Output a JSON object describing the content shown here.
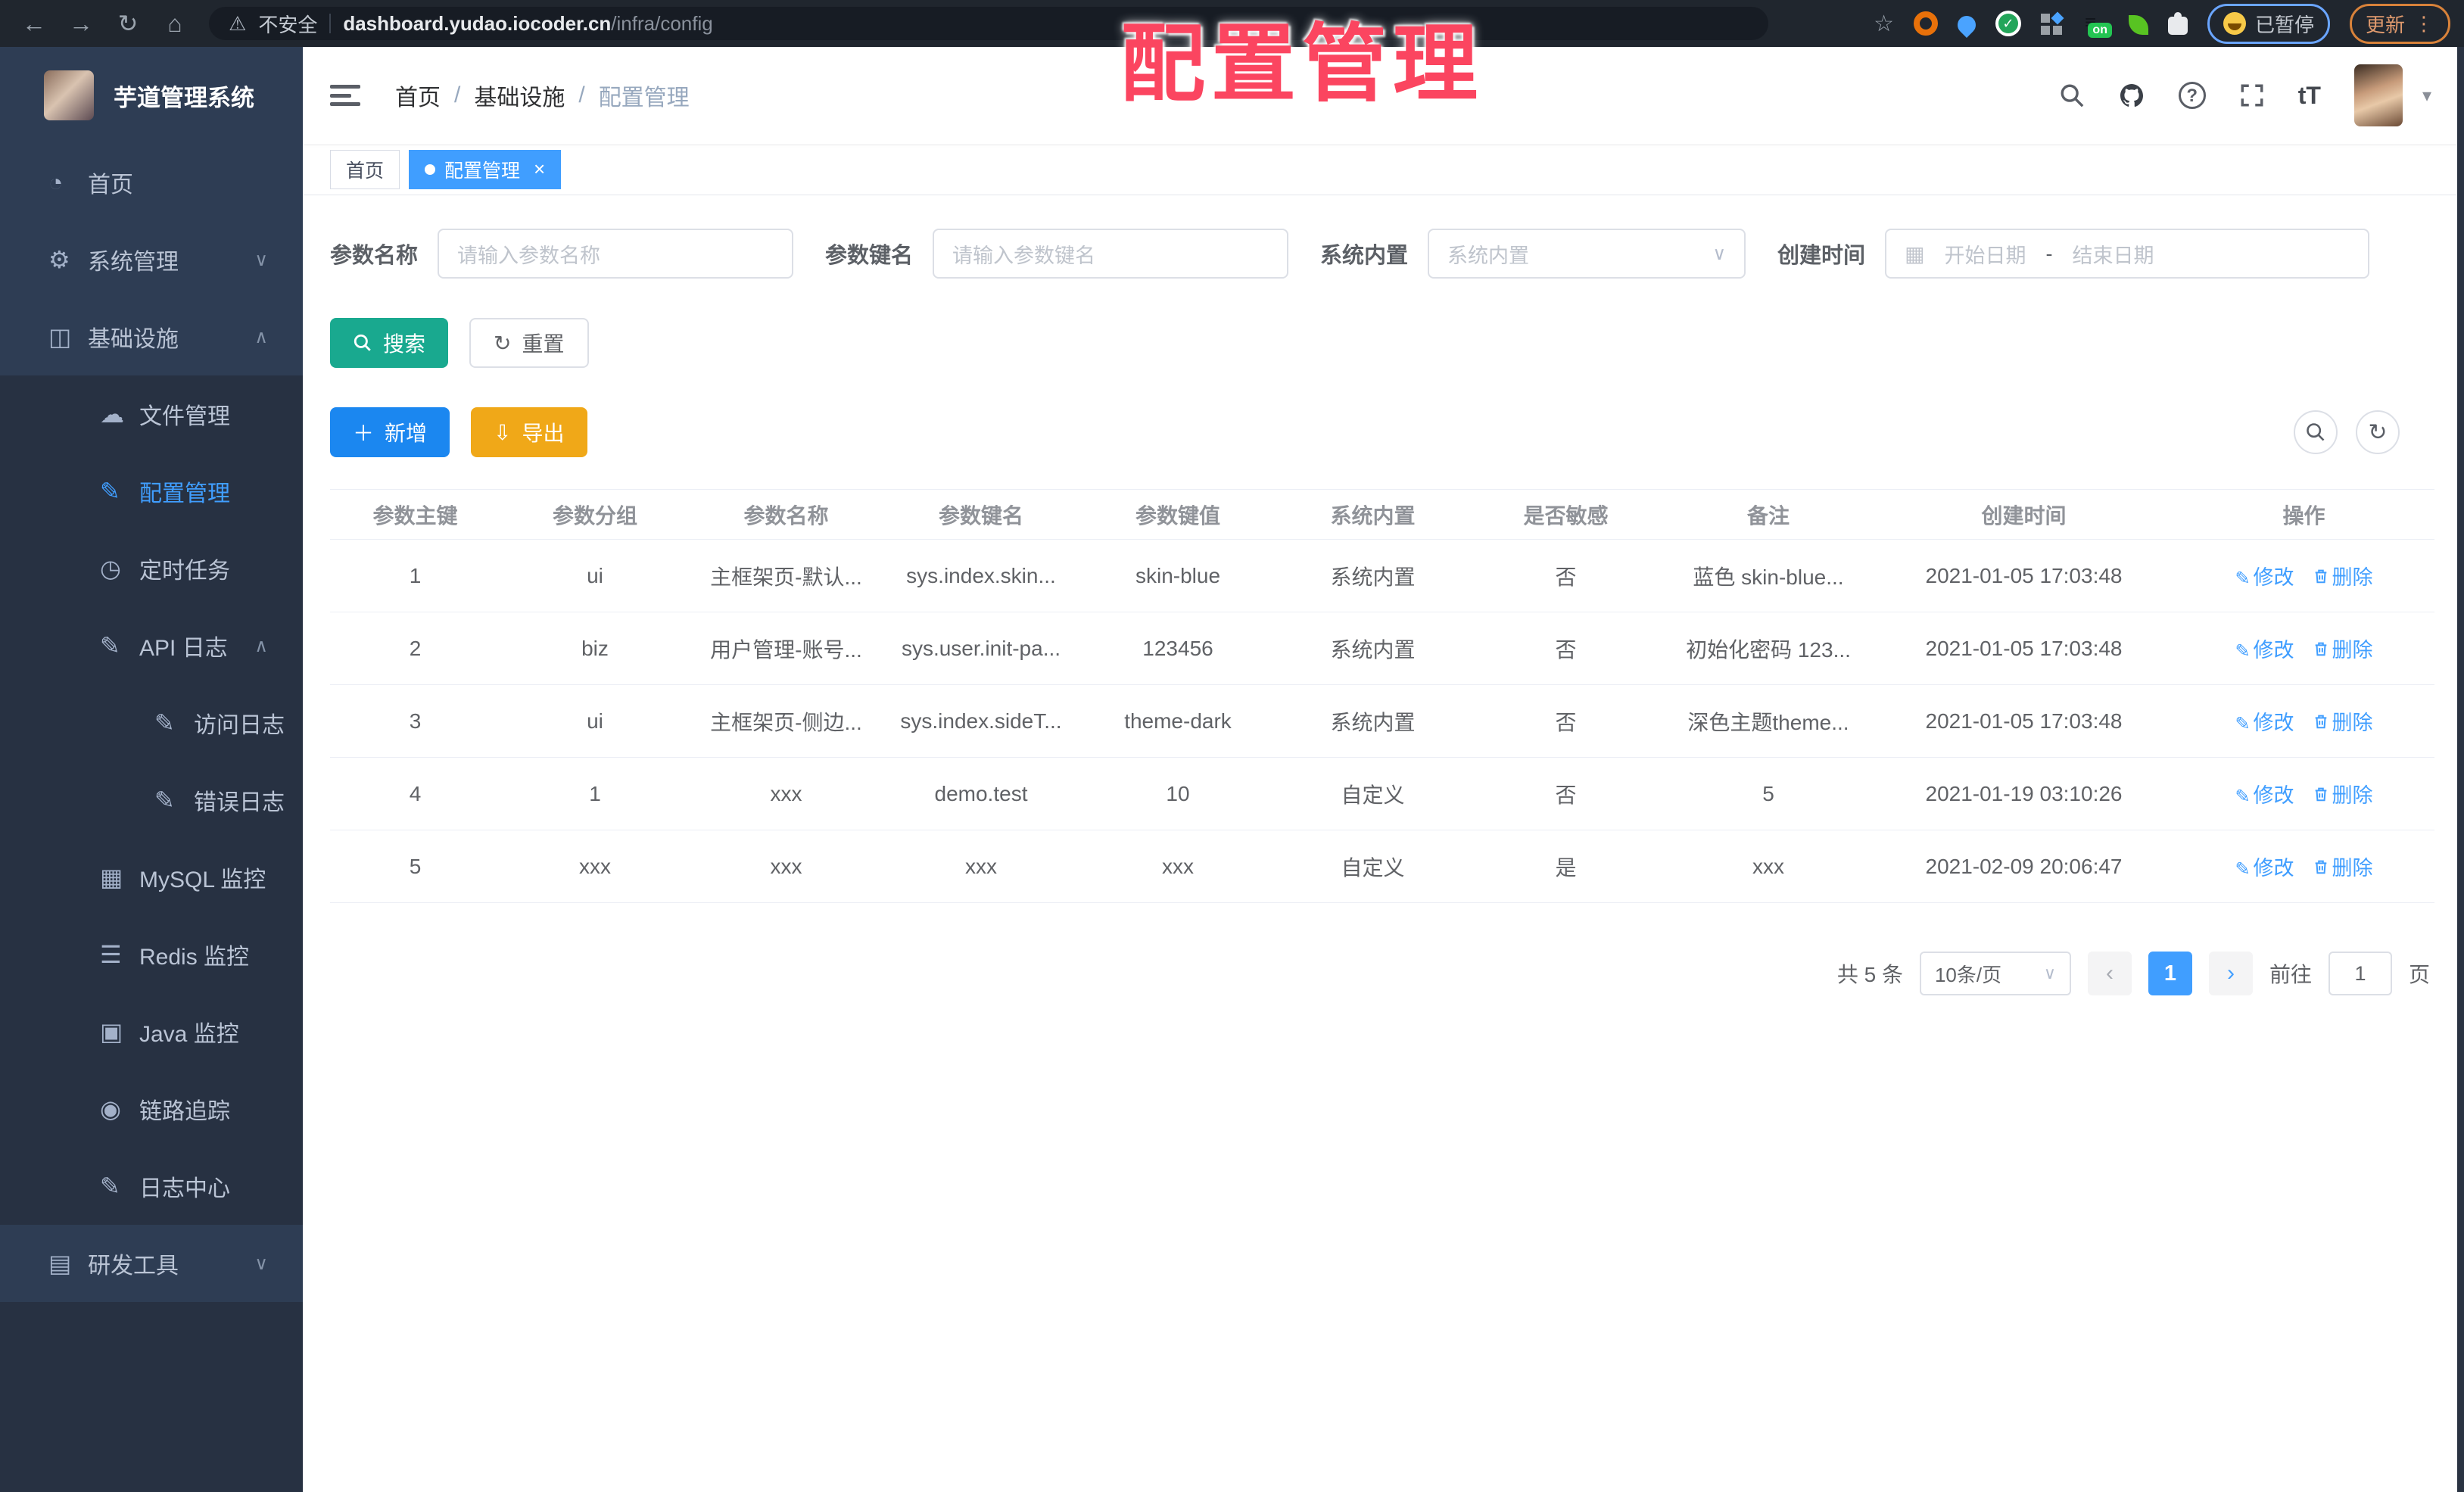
{
  "theme": {
    "primary": "#409eff",
    "teal": "#19a98f",
    "warning": "#f0a818",
    "sidebar_bg": "#2e3d54",
    "submenu_bg": "#273142",
    "overlay_pink": "#fb4560"
  },
  "overlay_title": "配置管理",
  "browser": {
    "security_label": "不安全",
    "url_host": "dashboard.yudao.iocoder.cn",
    "url_path": "/infra/config",
    "extension_on_badge": "on",
    "paused_badge": "已暂停",
    "update_button": "更新"
  },
  "sidebar": {
    "logo_title": "芋道管理系统",
    "items": [
      {
        "label": "首页"
      },
      {
        "label": "系统管理"
      },
      {
        "label": "基础设施"
      },
      {
        "label": "文件管理"
      },
      {
        "label": "配置管理"
      },
      {
        "label": "定时任务"
      },
      {
        "label": "API 日志"
      },
      {
        "label": "访问日志"
      },
      {
        "label": "错误日志"
      },
      {
        "label": "MySQL 监控"
      },
      {
        "label": "Redis 监控"
      },
      {
        "label": "Java 监控"
      },
      {
        "label": "链路追踪"
      },
      {
        "label": "日志中心"
      },
      {
        "label": "研发工具"
      }
    ]
  },
  "header": {
    "breadcrumb": [
      {
        "label": "首页"
      },
      {
        "label": "基础设施"
      },
      {
        "label": "配置管理"
      }
    ],
    "font_icon_label": "tT"
  },
  "tabs": [
    {
      "label": "首页"
    },
    {
      "label": "配置管理"
    }
  ],
  "filters": {
    "name": {
      "label": "参数名称",
      "placeholder": "请输入参数名称"
    },
    "key": {
      "label": "参数键名",
      "placeholder": "请输入参数键名"
    },
    "type": {
      "label": "系统内置",
      "placeholder": "系统内置"
    },
    "date": {
      "label": "创建时间",
      "start": "开始日期",
      "separator": "-",
      "end": "结束日期"
    }
  },
  "toolbar": {
    "search_label": "搜索",
    "reset_label": "重置",
    "add_label": "新增",
    "export_label": "导出"
  },
  "table": {
    "columns": [
      "参数主键",
      "参数分组",
      "参数名称",
      "参数键名",
      "参数键值",
      "系统内置",
      "是否敏感",
      "备注",
      "创建时间",
      "操作"
    ],
    "edit_label": "修改",
    "delete_label": "删除",
    "rows": [
      {
        "id": "1",
        "group": "ui",
        "name": "主框架页-默认...",
        "key": "sys.index.skin...",
        "value": "skin-blue",
        "builtin": "系统内置",
        "sensitive": "否",
        "remark": "蓝色 skin-blue...",
        "created": "2021-01-05 17:03:48"
      },
      {
        "id": "2",
        "group": "biz",
        "name": "用户管理-账号...",
        "key": "sys.user.init-pa...",
        "value": "123456",
        "builtin": "系统内置",
        "sensitive": "否",
        "remark": "初始化密码 123...",
        "created": "2021-01-05 17:03:48"
      },
      {
        "id": "3",
        "group": "ui",
        "name": "主框架页-侧边...",
        "key": "sys.index.sideT...",
        "value": "theme-dark",
        "builtin": "系统内置",
        "sensitive": "否",
        "remark": "深色主题theme...",
        "created": "2021-01-05 17:03:48"
      },
      {
        "id": "4",
        "group": "1",
        "name": "xxx",
        "key": "demo.test",
        "value": "10",
        "builtin": "自定义",
        "sensitive": "否",
        "remark": "5",
        "created": "2021-01-19 03:10:26"
      },
      {
        "id": "5",
        "group": "xxx",
        "name": "xxx",
        "key": "xxx",
        "value": "xxx",
        "builtin": "自定义",
        "sensitive": "是",
        "remark": "xxx",
        "created": "2021-02-09 20:06:47"
      }
    ]
  },
  "pagination": {
    "total": "共 5 条",
    "page_size": "10条/页",
    "current_page": "1",
    "goto_label": "前往",
    "goto_value": "1",
    "page_unit": "页"
  }
}
